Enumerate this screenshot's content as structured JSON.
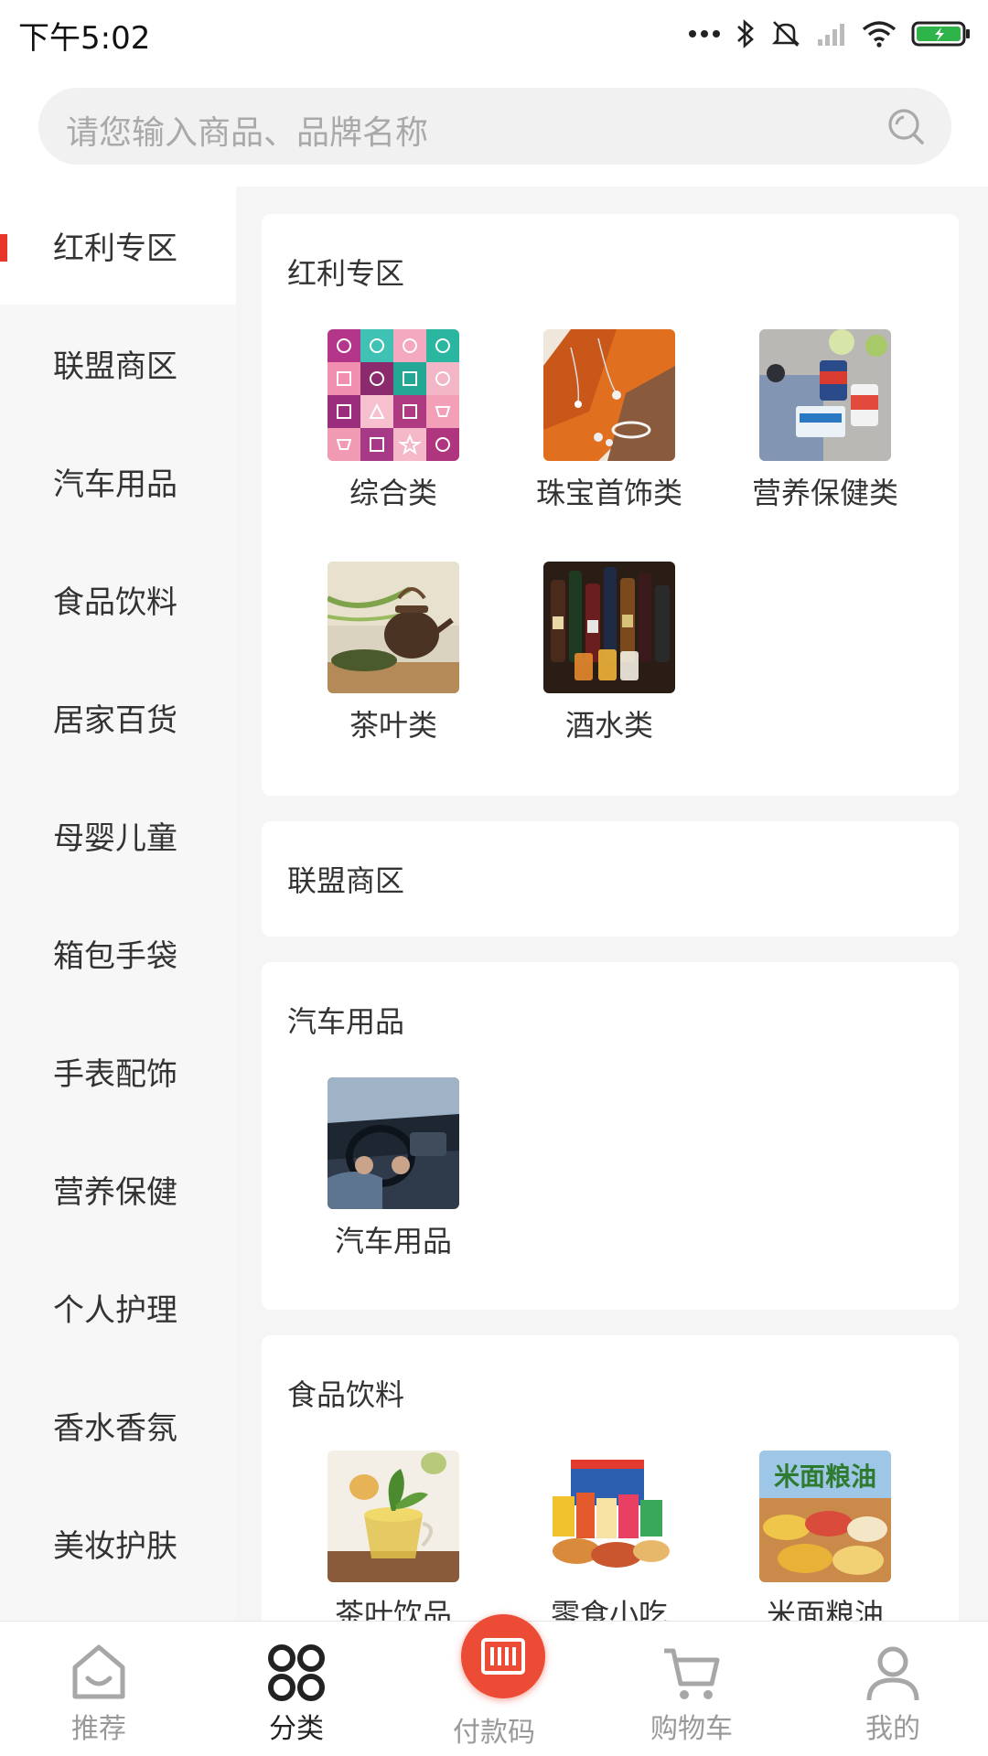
{
  "status_bar": {
    "time": "下午5:02"
  },
  "search": {
    "placeholder": "请您输入商品、品牌名称"
  },
  "sidebar": {
    "items": [
      {
        "label": "红利专区"
      },
      {
        "label": "联盟商区"
      },
      {
        "label": "汽车用品"
      },
      {
        "label": "食品饮料"
      },
      {
        "label": "居家百货"
      },
      {
        "label": "母婴儿童"
      },
      {
        "label": "箱包手袋"
      },
      {
        "label": "手表配饰"
      },
      {
        "label": "营养保健"
      },
      {
        "label": "个人护理"
      },
      {
        "label": "香水香氛"
      },
      {
        "label": "美妆护肤"
      }
    ],
    "active_index": 0
  },
  "sections": [
    {
      "title": "红利专区",
      "tiles": [
        {
          "label": "综合类",
          "image": "category-icon-grid"
        },
        {
          "label": "珠宝首饰类",
          "image": "jewelry-photo"
        },
        {
          "label": "营养保健类",
          "image": "supplements-photo"
        },
        {
          "label": "茶叶类",
          "image": "tea-pot-photo"
        },
        {
          "label": "酒水类",
          "image": "liquor-bottles-photo"
        }
      ]
    },
    {
      "title": "联盟商区",
      "tiles": []
    },
    {
      "title": "汽车用品",
      "tiles": [
        {
          "label": "汽车用品",
          "image": "car-interior-photo"
        }
      ]
    },
    {
      "title": "食品饮料",
      "tiles": [
        {
          "label": "茶叶饮品",
          "image": "tea-cup-photo"
        },
        {
          "label": "零食小吃",
          "image": "snacks-photo"
        },
        {
          "label": "米面粮油",
          "image": "grains-photo",
          "overlay_text": "米面粮油"
        }
      ]
    }
  ],
  "bottom_nav": {
    "items": [
      {
        "label": "推荐",
        "icon": "home-icon"
      },
      {
        "label": "分类",
        "icon": "category-icon"
      },
      {
        "label": "付款码",
        "icon": "barcode-icon"
      },
      {
        "label": "购物车",
        "icon": "cart-icon"
      },
      {
        "label": "我的",
        "icon": "user-icon"
      }
    ],
    "active_index": 1
  },
  "colors": {
    "accent": "#ec4b35",
    "active_marker": "#e8372a",
    "battery": "#2fb44a"
  }
}
